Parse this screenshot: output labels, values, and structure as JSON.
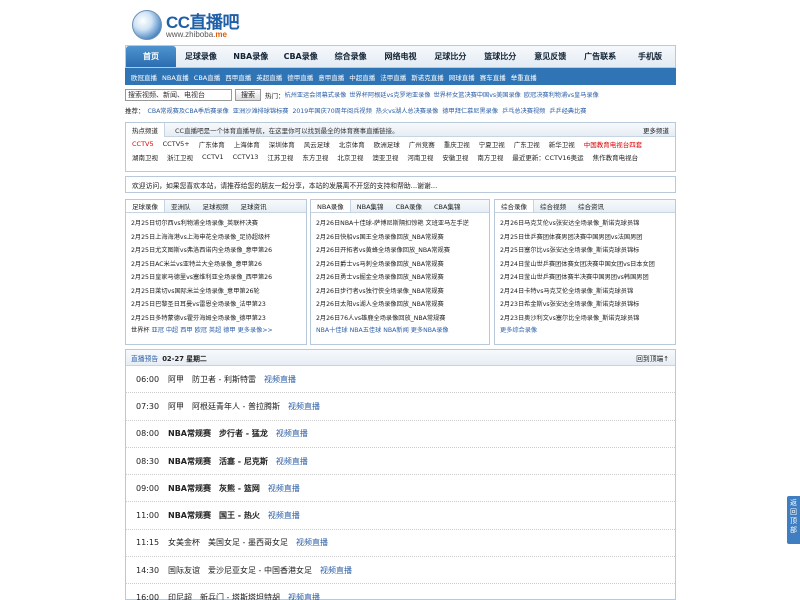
{
  "logo": {
    "title": "CC直播吧",
    "url_main": "www.zhiboba.",
    "url_tld": "me"
  },
  "nav": [
    "首页",
    "足球录像",
    "NBA录像",
    "CBA录像",
    "综合录像",
    "网络电视",
    "足球比分",
    "篮球比分",
    "意见反馈",
    "广告联系",
    "手机版"
  ],
  "subnav": [
    "欧冠直播",
    "NBA直播",
    "CBA直播",
    "西甲直播",
    "英超直播",
    "德甲直播",
    "意甲直播",
    "中超直播",
    "法甲直播",
    "斯诺克直播",
    "网球直播",
    "赛车直播",
    "举重直播"
  ],
  "search": {
    "value": "搜索视频、新闻、电视台",
    "button": "搜索",
    "hot_label": "热门：",
    "hot": [
      "杭州亚运会闭幕式录像",
      "世界杯阿根廷vs克罗地亚录像",
      "世界杯女篮决赛中国vs美国录像",
      "欧冠决赛利物浦vs皇马录像"
    ]
  },
  "recommend": {
    "label": "推荐：",
    "items": [
      "CBA常规赛及CBA季后赛录像",
      "亚洲沙滩排球锦标赛",
      "2019年国庆70周年阅兵视频",
      "热火vs湖人总决赛录像",
      "德甲拜仁慕尼黑录像",
      "乒乓总决赛视频",
      "乒乒经典比赛"
    ]
  },
  "channels": {
    "tab": "热点频道",
    "desc": "CC直播吧是一个体育直播导航，在这里你可以找到最全的体育赛事直播链接。",
    "more": "更多频道",
    "row1": [
      "CCTV5",
      "CCTV5+",
      "广东体育",
      "上海体育",
      "深圳体育",
      "风云足球",
      "北京体育",
      "欧洲足球",
      "广州竞赛",
      "重庆卫视",
      "宁夏卫视",
      "广东卫视",
      "新华卫视",
      "中国教育电视台四套"
    ],
    "row2": [
      "湖南卫视",
      "浙江卫视",
      "CCTV1",
      "CCTV13",
      "江苏卫视",
      "东方卫视",
      "北京卫视",
      "澳亚卫视",
      "河南卫视",
      "安徽卫视",
      "南方卫视",
      "最近更新：CCTV16奥运",
      "焦作教育电视台"
    ]
  },
  "welcome": "欢迎访问，如果您喜欢本站，请推荐给您的朋友一起分享，本站的发展离不开您的支持和帮助...谢谢...",
  "col1": {
    "tabs": [
      "足球录像",
      "亚洲队",
      "足球视频",
      "足球资讯"
    ],
    "items": [
      "2月25日切尔西vs利物浦全场录像_英联杯决赛",
      "2月25日上海海港vs上海申花全场录像_足协超级杯",
      "2月25日尤文图斯vs弗洛西诺内全场录像_意甲第26",
      "2月25日AC米兰vs亚特兰大全场录像_意甲第26",
      "2月25日皇家马德里vs塞维利亚全场录像_西甲第26",
      "2月25日莱切vs国际米兰全场录像_意甲第26轮",
      "2月25日巴黎圣日耳曼vs雷恩全场录像_法甲第23",
      "2月25日多特蒙德vs霍芬海姆全场录像_德甲第23"
    ],
    "foot_label": "世界杯",
    "foot": [
      "亚冠",
      "中超",
      "西甲",
      "欧冠",
      "英超",
      "德甲",
      "更多录像>>"
    ]
  },
  "col2": {
    "tabs": [
      "NBA录像",
      "NBA集锦",
      "CBA录像",
      "CBA集锦"
    ],
    "items": [
      "2月26日NBA十佳球-萨博尼斯隔扣惊艳 文班亚马左手逆",
      "2月26日快船vs国王全场录像回放_NBA常规赛",
      "2月26日开拓者vs黄蜂全场录像回放_NBA常规赛",
      "2月26日爵士vs马刺全场录像回放_NBA常规赛",
      "2月26日勇士vs掘金全场录像回放_NBA常规赛",
      "2月26日步行者vs独行侠全场录像_NBA常规赛",
      "2月26日太阳vs湖人全场录像回放_NBA常规赛",
      "2月26日76人vs雄鹿全场录像回放_NBA常规赛"
    ],
    "foot": [
      "NBA十佳球",
      "NBA五佳球",
      "NBA新闻",
      "更多NBA录像"
    ]
  },
  "col3": {
    "tabs": [
      "综合录像",
      "综合视频",
      "综合资讯"
    ],
    "items": [
      "2月26日马克艾伦vs张安达全场录像_斯诺克球员锦",
      "2月25日世乒赛团体赛男团决赛中国男团vs法国男团",
      "2月25日塞尔比vs张安达全场录像_斯诺克球员锦标",
      "2月24日釜山世乒赛团体赛女团决赛中国女团vs日本女团",
      "2月24日釜山世乒赛团体赛半决赛中国男团vs韩国男团",
      "2月24日卡特vs马克艾伦全场录像_斯诺克球员锦",
      "2月23日希金斯vs张安达全场录像_斯诺克球员锦标",
      "2月23日奥沙利文vs塞尔比全场录像_斯诺克球员锦"
    ],
    "foot": [
      "更多综合录像"
    ]
  },
  "schedule": {
    "title": "直播预告",
    "date": "02-27 星期二",
    "back": "回到顶端↑",
    "link": "视频直播",
    "rows": [
      {
        "time": "06:00",
        "event": "阿甲",
        "match": "防卫者 - 利斯特雷",
        "bold": false
      },
      {
        "time": "07:30",
        "event": "阿甲",
        "match": "阿根廷青年人 - 普拉腾斯",
        "bold": false
      },
      {
        "time": "08:00",
        "event": "NBA常规赛",
        "match": "步行者 - 猛龙",
        "bold": true
      },
      {
        "time": "08:30",
        "event": "NBA常规赛",
        "match": "活塞 - 尼克斯",
        "bold": true
      },
      {
        "time": "09:00",
        "event": "NBA常规赛",
        "match": "灰熊 - 篮网",
        "bold": true
      },
      {
        "time": "11:00",
        "event": "NBA常规赛",
        "match": "国王 - 热火",
        "bold": true
      },
      {
        "time": "11:15",
        "event": "女美金杯",
        "match": "美国女足 - 墨西哥女足",
        "bold": false
      },
      {
        "time": "14:30",
        "event": "国际友谊",
        "match": "爱沙尼亚女足 - 中国香港女足",
        "bold": false
      },
      {
        "time": "16:00",
        "event": "印尼超",
        "match": "新兵门 - 塔斯塔坦特胡",
        "bold": false
      }
    ]
  },
  "totop": "返回顶部"
}
